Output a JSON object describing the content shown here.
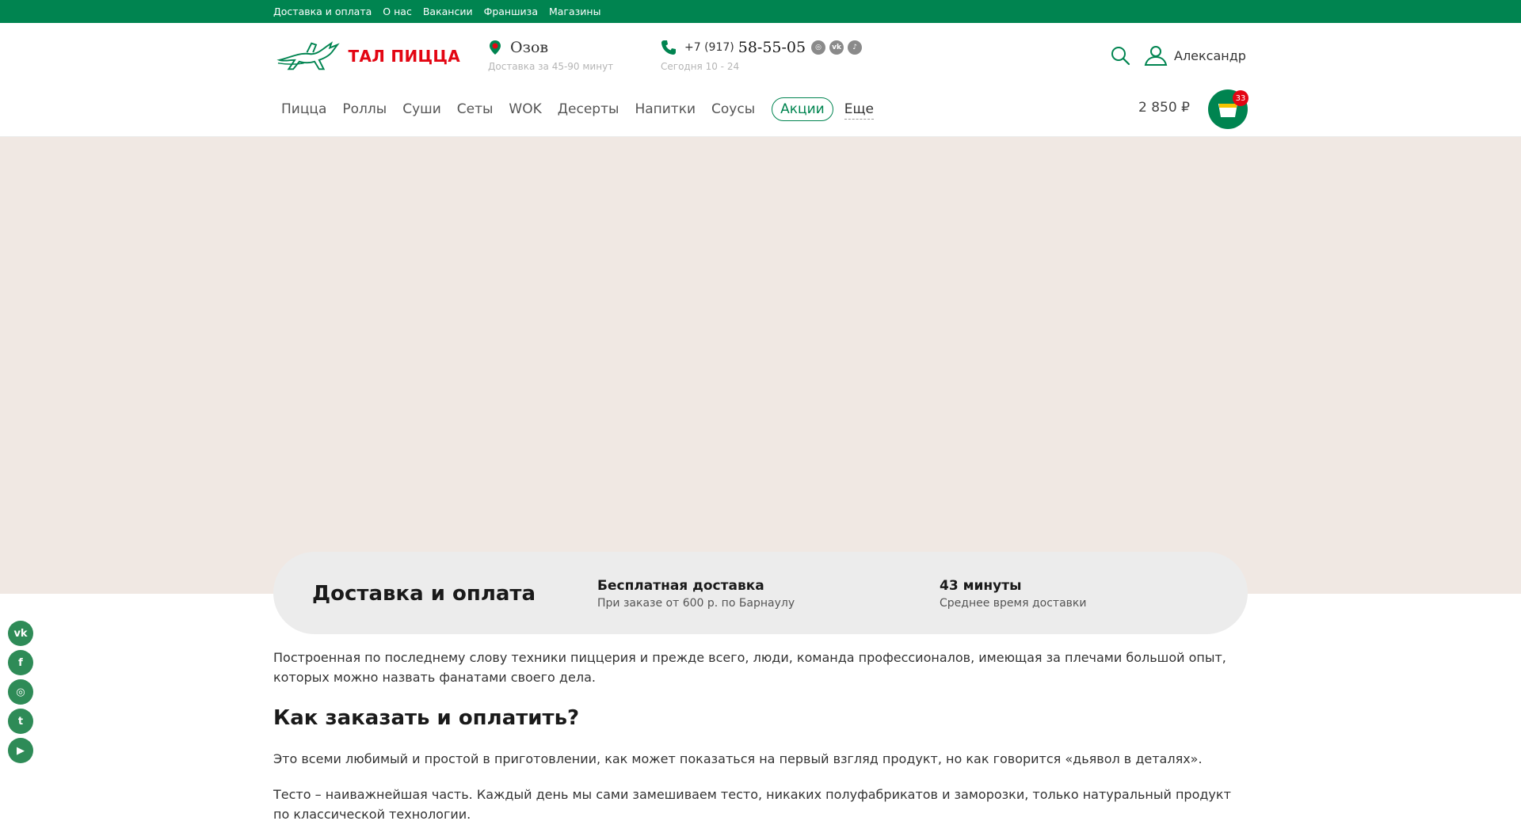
{
  "topbar": {
    "links": [
      "Доставка и оплата",
      "О нас",
      "Вакансии",
      "Франшиза",
      "Магазины"
    ]
  },
  "header": {
    "logo_text": "ТАЛ ПИЦЦА",
    "city": "Озов",
    "city_sub": "Доставка за 45-90 минут",
    "phone_prefix": "+7 (917)",
    "phone_main": "58-55-05",
    "hours": "Сегодня 10 - 24",
    "user_name": "Александр",
    "social_icons": [
      "instagram-icon",
      "vk-icon",
      "tiktok-icon"
    ]
  },
  "nav": {
    "items": [
      "Пицца",
      "Роллы",
      "Суши",
      "Сеты",
      "WOK",
      "Десерты",
      "Напитки",
      "Соусы"
    ],
    "promo": "Акции",
    "more": "Еще"
  },
  "cart": {
    "total": "2 850 ₽",
    "count": "33"
  },
  "info": {
    "title": "Доставка и оплата",
    "blocks": [
      {
        "heading": "Бесплатная доставка",
        "sub": "При заказе от 600 р. по Барнаулу"
      },
      {
        "heading": "43 минуты",
        "sub": "Среднее время доставки"
      }
    ]
  },
  "content": {
    "intro": "Построенная по последнему слову техники пиццерия и прежде всего, люди, команда профессионалов, имеющая за плечами большой опыт, которых можно назвать фанатами своего дела.",
    "heading": "Как заказать и оплатить?",
    "p1": "Это всеми любимый и простой в приготовлении, как может показаться на первый взгляд продукт, но как говорится «дьявол в деталях».",
    "p2": "Тесто – наиважнейшая часть. Каждый день мы сами замешиваем тесто, никаких полуфабрикатов и заморозки, только натуральный продукт по классической технологии."
  },
  "float_social": [
    "vk-icon",
    "facebook-icon",
    "instagram-icon",
    "twitter-icon",
    "youtube-icon"
  ],
  "colors": {
    "brand_green": "#008450",
    "brand_red": "#e30613",
    "banner_bg": "#f0e8e3",
    "card_bg": "#ececec"
  }
}
